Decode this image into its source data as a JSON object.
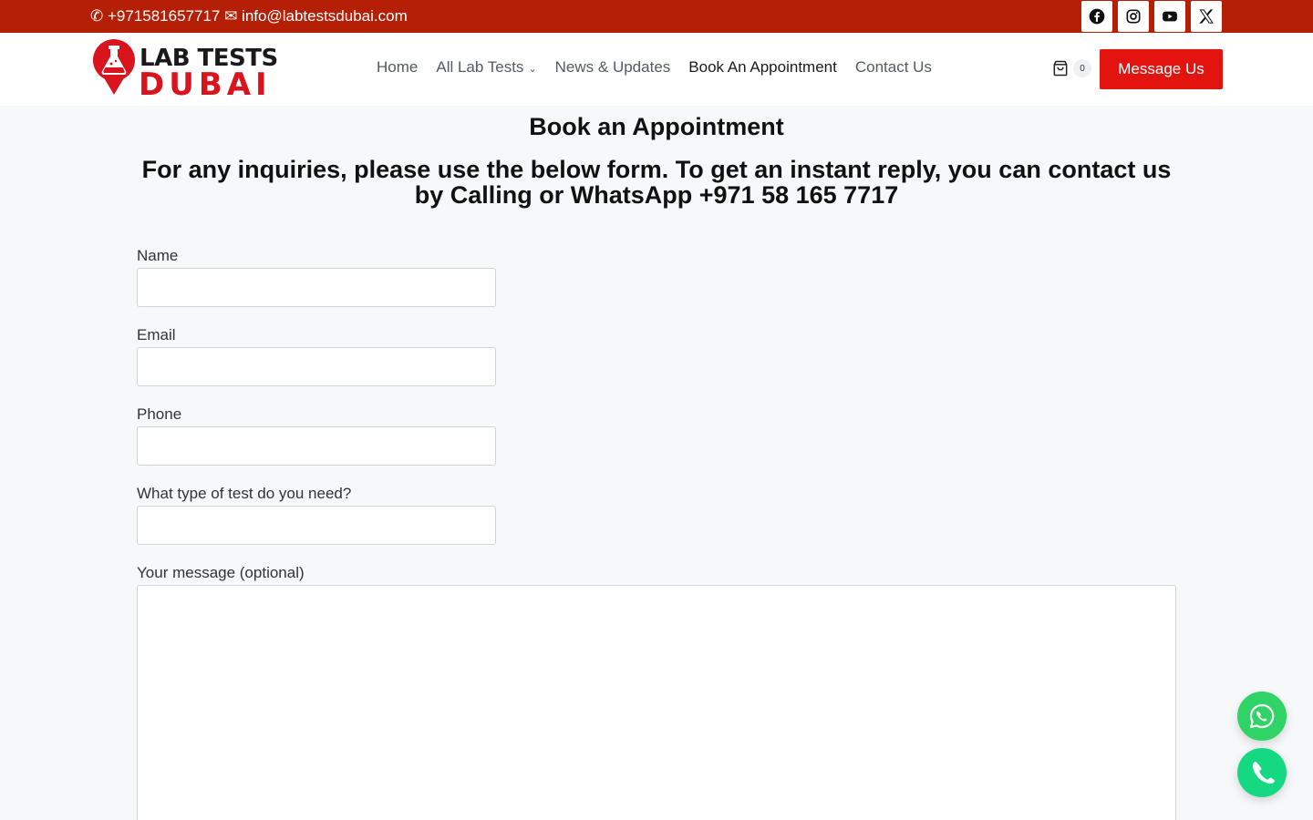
{
  "topbar": {
    "contact_text": "✆ +971581657717 ✉ info@labtestsdubai.com",
    "socials": [
      {
        "icon": "facebook-icon"
      },
      {
        "icon": "instagram-icon"
      },
      {
        "icon": "youtube-icon"
      },
      {
        "icon": "x-twitter-icon"
      }
    ]
  },
  "brand": {
    "line1": "LAB TESTS",
    "line2": "DUBAI",
    "accent_color": "#d9141c",
    "topbar_color": "#b51f06"
  },
  "nav": {
    "items": [
      {
        "label": "Home"
      },
      {
        "label": "All Lab Tests"
      },
      {
        "label": "News & Updates"
      },
      {
        "label": "Book An Appointment"
      },
      {
        "label": "Contact Us"
      }
    ],
    "cart_count": "0",
    "message_button": "Message Us"
  },
  "page": {
    "title": "Book an Appointment",
    "subtitle": "For any inquiries, please use the below form. To get an instant reply, you can contact us by Calling or WhatsApp +971 58 165 7717"
  },
  "form": {
    "name_label": "Name",
    "name_value": "",
    "email_label": "Email",
    "email_value": "",
    "phone_label": "Phone",
    "phone_value": "",
    "test_label": "What type of test do you need?",
    "test_value": "",
    "message_label": "Your message (optional)",
    "message_value": ""
  },
  "floating": {
    "whatsapp_icon": "whatsapp-icon",
    "phone_icon": "phone-icon",
    "whatsapp_color": "#2fd366",
    "phone_color": "#14d982"
  }
}
